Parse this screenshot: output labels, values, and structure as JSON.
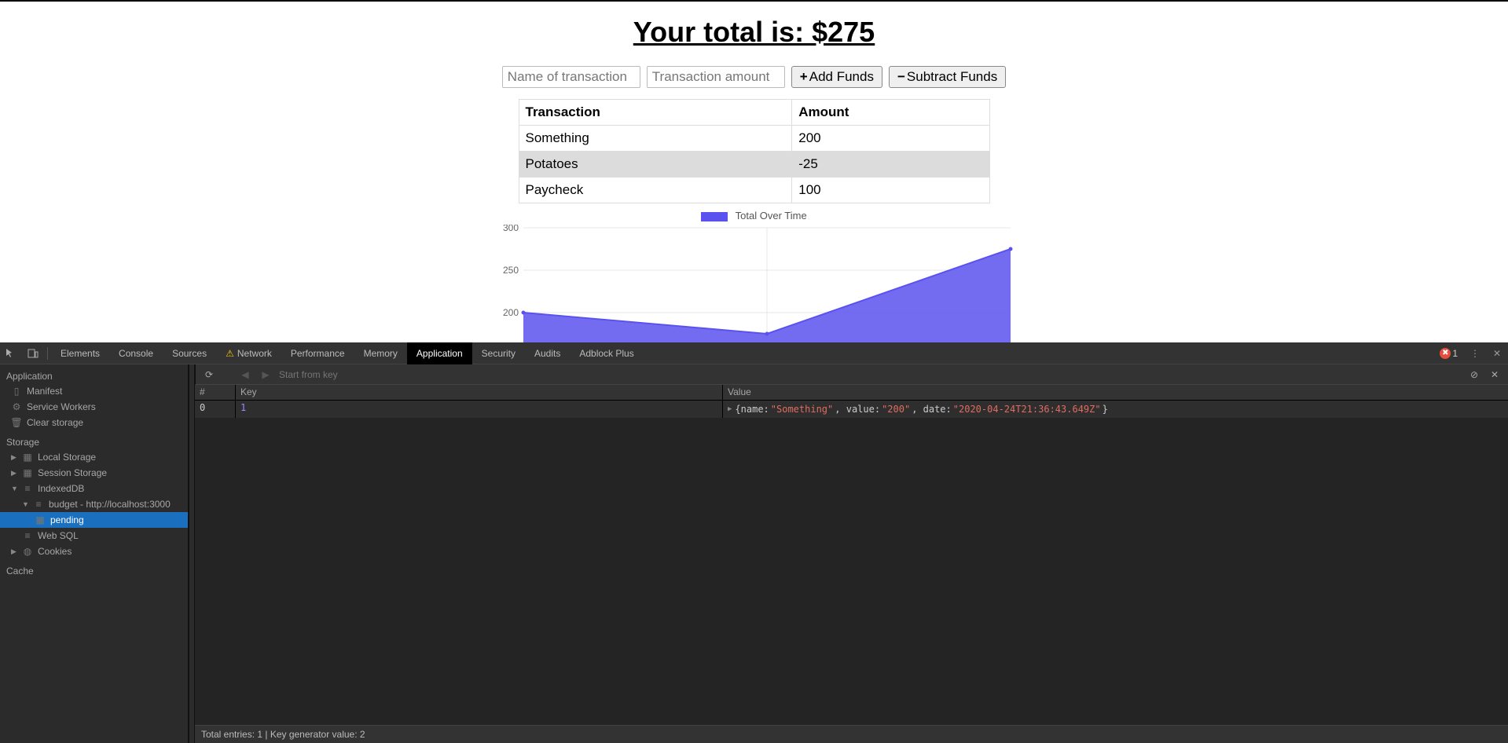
{
  "total_heading": "Your total is: $275",
  "form": {
    "name_placeholder": "Name of transaction",
    "amount_placeholder": "Transaction amount",
    "add_label": "Add Funds",
    "sub_label": "Subtract Funds"
  },
  "table": {
    "col_transaction": "Transaction",
    "col_amount": "Amount",
    "rows": [
      {
        "transaction": "Something",
        "amount": "200"
      },
      {
        "transaction": "Potatoes",
        "amount": "-25"
      },
      {
        "transaction": "Paycheck",
        "amount": "100"
      }
    ]
  },
  "chart_data": {
    "type": "area",
    "title": "Total Over Time",
    "x": [
      0,
      1,
      2
    ],
    "values": [
      200,
      175,
      275
    ],
    "ylim": [
      150,
      300
    ],
    "yticks": [
      200,
      250,
      300
    ],
    "series": [
      {
        "name": "Total Over Time",
        "color": "#5a52ee"
      }
    ]
  },
  "devtools": {
    "tabs": [
      "Elements",
      "Console",
      "Sources",
      "Network",
      "Performance",
      "Memory",
      "Application",
      "Security",
      "Audits",
      "Adblock Plus"
    ],
    "active_tab": "Application",
    "warn_tab": "Network",
    "err_count": "1",
    "sidebar": {
      "application_label": "Application",
      "manifest": "Manifest",
      "service_workers": "Service Workers",
      "clear_storage": "Clear storage",
      "storage_label": "Storage",
      "local_storage": "Local Storage",
      "session_storage": "Session Storage",
      "indexeddb": "IndexedDB",
      "budget_db": "budget - http://localhost:3000",
      "pending": "pending",
      "websql": "Web SQL",
      "cookies": "Cookies",
      "cache_label": "Cache"
    },
    "idb": {
      "start_placeholder": "Start from key",
      "col_hash": "#",
      "col_key": "Key",
      "col_value": "Value",
      "row": {
        "index": "0",
        "key": "1",
        "value_prefix": "{name: ",
        "name": "\"Something\"",
        "sep1": ", value: ",
        "value": "\"200\"",
        "sep2": ", date: ",
        "date": "\"2020-04-24T21:36:43.649Z\"",
        "suffix": "}"
      },
      "status": "Total entries: 1 | Key generator value: 2"
    }
  }
}
